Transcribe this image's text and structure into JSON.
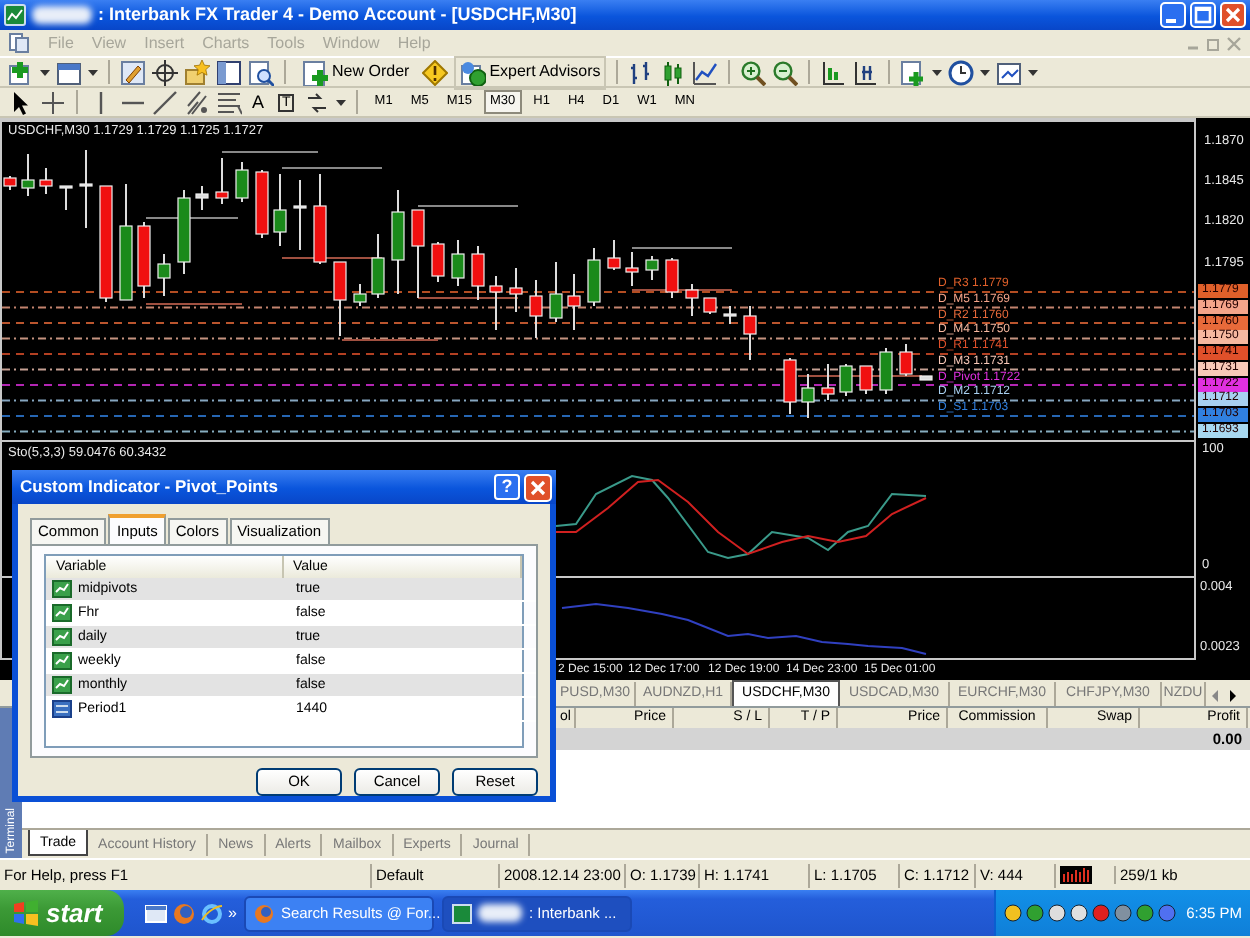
{
  "window": {
    "title": ": Interbank FX Trader 4 - Demo Account - [USDCHF,M30]"
  },
  "menu": [
    {
      "label": "File",
      "disabled": true
    },
    {
      "label": "View",
      "disabled": true
    },
    {
      "label": "Insert",
      "disabled": true
    },
    {
      "label": "Charts",
      "disabled": true
    },
    {
      "label": "Tools",
      "disabled": true
    },
    {
      "label": "Window",
      "disabled": true
    },
    {
      "label": "Help",
      "disabled": true
    }
  ],
  "toolbar": {
    "new_order": "New Order",
    "expert_advisors": "Expert Advisors",
    "text_tool": "A",
    "label_tool": "T"
  },
  "timeframes": [
    {
      "label": "M1",
      "selected": false
    },
    {
      "label": "M5",
      "selected": false
    },
    {
      "label": "M15",
      "selected": false
    },
    {
      "label": "M30",
      "selected": true
    },
    {
      "label": "H1",
      "selected": false
    },
    {
      "label": "H4",
      "selected": false
    },
    {
      "label": "D1",
      "selected": false
    },
    {
      "label": "W1",
      "selected": false
    },
    {
      "label": "MN",
      "selected": false
    }
  ],
  "chart": {
    "header": "USDCHF,M30  1.1729 1.1729 1.1725 1.1727",
    "price_axis": [
      "1.1870",
      "1.1845",
      "1.1820",
      "1.1795"
    ],
    "pivots": [
      {
        "kind": "main",
        "label": "D_R3 1.1779",
        "tag": "1.1779",
        "color": "#e0602a"
      },
      {
        "kind": "mid",
        "label": "D_M5 1.1769",
        "tag": "1.1769",
        "color": "#f4a48a"
      },
      {
        "kind": "main",
        "label": "D_R2 1.1760",
        "tag": "1.1760",
        "color": "#e86a3a"
      },
      {
        "kind": "mid",
        "label": "D_M4 1.1750",
        "tag": "1.1750",
        "color": "#f6b8a0"
      },
      {
        "kind": "main",
        "label": "D_R1 1.1741",
        "tag": "1.1741",
        "color": "#e0502a"
      },
      {
        "kind": "mid",
        "label": "D_M3 1.1731",
        "tag": "1.1731",
        "color": "#f8c8b8"
      },
      {
        "kind": "main",
        "label": "D_Pivot 1.1722",
        "tag": "1.1722",
        "color": "#e030e0"
      },
      {
        "kind": "mid",
        "label": "D_M2 1.1712",
        "tag": "1.1712",
        "color": "#a8d0f0"
      },
      {
        "kind": "main",
        "label": "D_S1 1.1703",
        "tag": "1.1703",
        "color": "#3080e0"
      },
      {
        "kind": "mid",
        "tag": "1.1693",
        "color": "#a8d8f0"
      }
    ],
    "oscillator": {
      "label": "Sto(5,3,3) 59.0476 60.3432",
      "axis": [
        "100",
        "0"
      ]
    },
    "macd_axis": [
      "0.004",
      "0.0023"
    ],
    "time_axis": [
      "2 Dec 15:00",
      "12 Dec 17:00",
      "12 Dec 19:00",
      "14 Dec 23:00",
      "15 Dec 01:00"
    ]
  },
  "chart_tabs": [
    {
      "label": "PUSD,M30",
      "selected": false
    },
    {
      "label": "AUDNZD,H1",
      "selected": false
    },
    {
      "label": "USDCHF,M30",
      "selected": true
    },
    {
      "label": "USDCAD,M30",
      "selected": false
    },
    {
      "label": "EURCHF,M30",
      "selected": false
    },
    {
      "label": "CHFJPY,M30",
      "selected": false
    },
    {
      "label": "NZDU",
      "selected": false
    }
  ],
  "terminal": {
    "side_label": "Terminal",
    "columns": [
      "ol",
      "Price",
      "S / L",
      "T / P",
      "Price",
      "Commission",
      "Swap",
      "Profit"
    ],
    "total_profit": "0.00",
    "tabs": [
      {
        "label": "Trade",
        "selected": true
      },
      {
        "label": "Account History",
        "selected": false
      },
      {
        "label": "News",
        "selected": false
      },
      {
        "label": "Alerts",
        "selected": false
      },
      {
        "label": "Mailbox",
        "selected": false
      },
      {
        "label": "Experts",
        "selected": false
      },
      {
        "label": "Journal",
        "selected": false
      }
    ]
  },
  "status_bar": [
    "For Help, press F1",
    "Default",
    "2008.12.14 23:00",
    "O: 1.1739",
    "H: 1.1741",
    "L: 1.1705",
    "C: 1.1712",
    "V: 444",
    "259/1 kb"
  ],
  "taskbar": {
    "start": "start",
    "more": "»",
    "tasks": [
      {
        "label": "Search Results @ For...",
        "selected": false
      },
      {
        "label": ": Interbank ...",
        "selected": true
      }
    ],
    "clock": "6:35 PM"
  },
  "dialog": {
    "title": "Custom Indicator - Pivot_Points",
    "help": "?",
    "tabs": [
      {
        "label": "Common",
        "selected": false
      },
      {
        "label": "Inputs",
        "selected": true
      },
      {
        "label": "Colors",
        "selected": false
      },
      {
        "label": "Visualization",
        "selected": false
      }
    ],
    "columns": [
      "Variable",
      "Value"
    ],
    "rows": [
      {
        "kind": "bool",
        "variable": "midpivots",
        "value": "true"
      },
      {
        "kind": "bool",
        "variable": "Fhr",
        "value": "false"
      },
      {
        "kind": "bool",
        "variable": "daily",
        "value": "true"
      },
      {
        "kind": "bool",
        "variable": "weekly",
        "value": "false"
      },
      {
        "kind": "bool",
        "variable": "monthly",
        "value": "false"
      },
      {
        "kind": "int",
        "variable": "Period1",
        "value": "1440"
      }
    ],
    "buttons": [
      "OK",
      "Cancel",
      "Reset"
    ]
  }
}
